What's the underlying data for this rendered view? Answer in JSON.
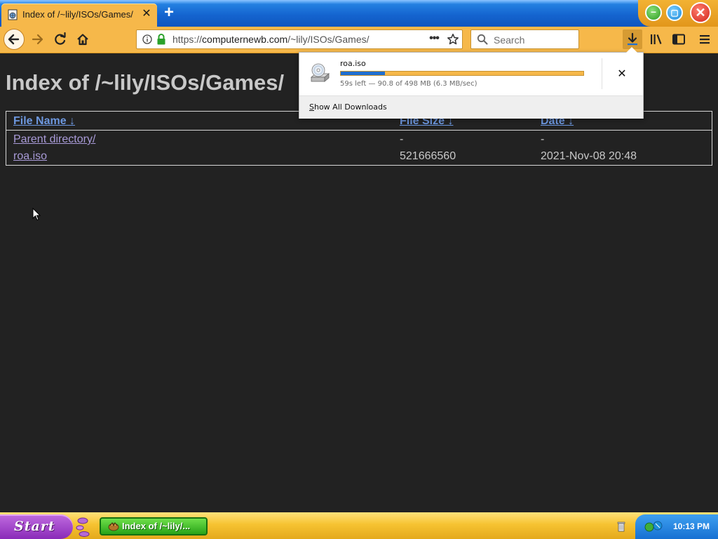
{
  "tab": {
    "title": "Index of /~lily/ISOs/Games/",
    "close_glyph": "✕"
  },
  "newtab": {
    "glyph": "+"
  },
  "window": {
    "min_glyph": "–",
    "max_glyph": "▢",
    "close_glyph": "✕"
  },
  "urlbar": {
    "url_prefix": "https://",
    "url_host": "computernewb.com",
    "url_path": "/~lily/ISOs/Games/",
    "more_glyph": "•••"
  },
  "searchbar": {
    "placeholder": "Search"
  },
  "page": {
    "title": "Index of /~lily/ISOs/Games/",
    "columns": {
      "name": "File Name  ↓",
      "size": "File Size  ↓",
      "date": "Date  ↓"
    },
    "rows": [
      {
        "name": "Parent directory/",
        "size": "-",
        "date": "-"
      },
      {
        "name": "roa.iso",
        "size": "521666560",
        "date": "2021-Nov-08 20:48"
      }
    ]
  },
  "downloads": {
    "filename": "roa.iso",
    "progress_fraction": 0.182,
    "status": "59s left — 90.8 of 498 MB (6.3 MB/sec)",
    "cancel_glyph": "✕",
    "show_all_accesskey": "S",
    "show_all_rest": "how All Downloads"
  },
  "taskbar": {
    "start_label": "Start",
    "task_label": "Index of /~lily/...",
    "clock": "10:13 PM"
  },
  "colors": {
    "page_bg": "#222222",
    "link": "#6d98e0",
    "visited_link": "#a99bd8",
    "toolbar": "#f6b84a",
    "progress_fill": "#1f6fd0",
    "tabstrip": "#1565d0",
    "taskbar": "#f6c332",
    "start_button": "#8a2bb8",
    "tray": "#1670d2"
  },
  "icons": {
    "tab_favicon": "page-globe-icon",
    "back": "back-arrow-icon",
    "forward": "forward-arrow-icon",
    "reload": "reload-icon",
    "home": "home-icon",
    "site_info": "info-icon",
    "lock": "lock-icon",
    "bookmark": "star-icon",
    "search": "search-icon",
    "downloads": "download-arrow-icon",
    "library": "library-icon",
    "sidebar": "sidebar-icon",
    "menu": "hamburger-menu-icon",
    "download_item": "cd-drive-icon"
  }
}
